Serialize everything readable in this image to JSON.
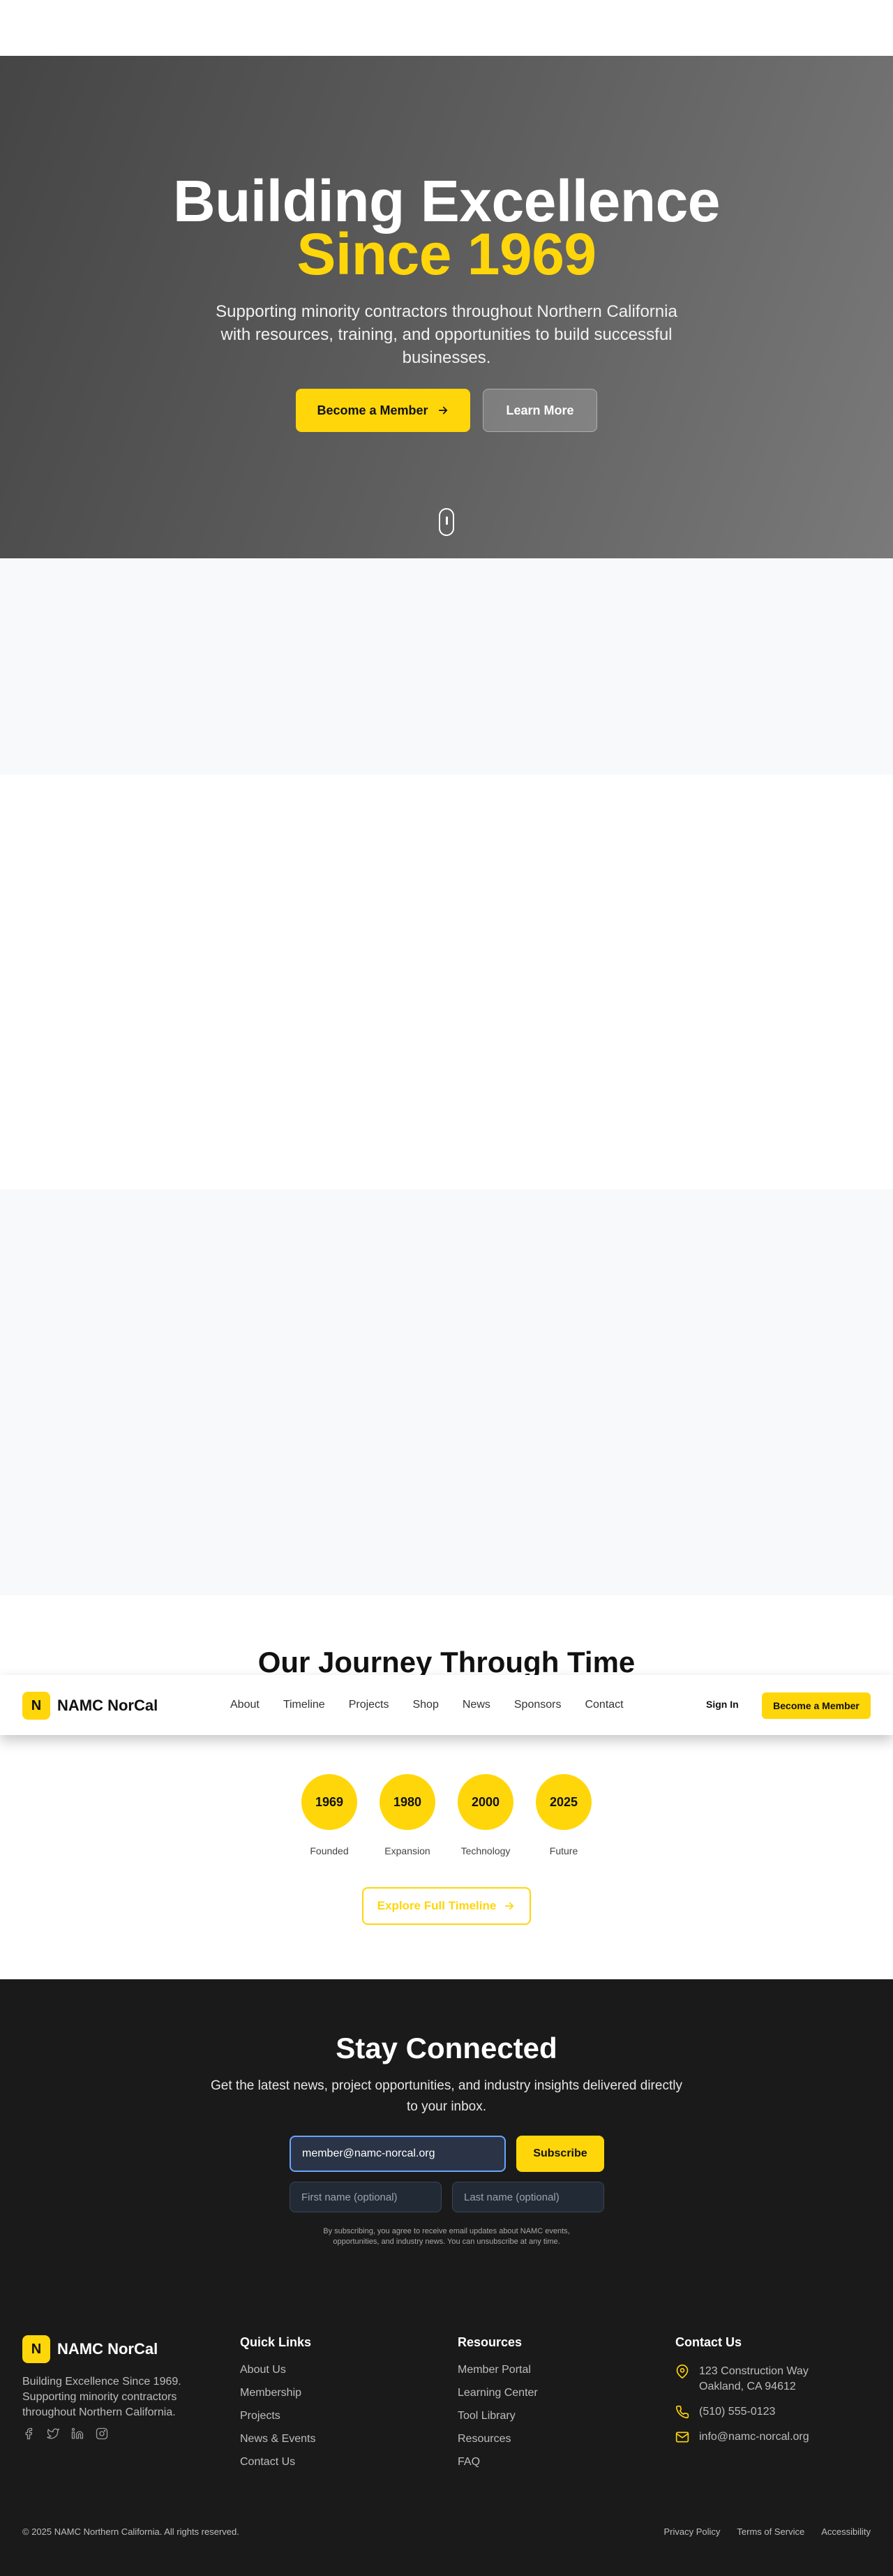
{
  "nav": {
    "logo_letter": "N",
    "brand": "NAMC NorCal",
    "links": [
      "About",
      "Timeline",
      "Projects",
      "Shop",
      "News",
      "Sponsors",
      "Contact"
    ],
    "sign_in": "Sign In",
    "cta": "Become a Member"
  },
  "hero": {
    "title_line1": "Building Excellence",
    "title_line2": "Since 1969",
    "subtitle": "Supporting minority contractors throughout Northern California with resources, training, and opportunities to build successful businesses.",
    "primary_button": "Become a Member",
    "secondary_button": "Learn More"
  },
  "timeline": {
    "title": "Our Journey Through Time",
    "items": [
      {
        "year": "1969",
        "label": "Founded"
      },
      {
        "year": "1980",
        "label": "Expansion"
      },
      {
        "year": "2000",
        "label": "Technology"
      },
      {
        "year": "2025",
        "label": "Future"
      }
    ],
    "button": "Explore Full Timeline"
  },
  "newsletter": {
    "title": "Stay Connected",
    "subtitle": "Get the latest news, project opportunities, and industry insights delivered directly to your inbox.",
    "email_value": "member@namc-norcal.org",
    "subscribe": "Subscribe",
    "first_name_placeholder": "First name (optional)",
    "last_name_placeholder": "Last name (optional)",
    "fine_print": "By subscribing, you agree to receive email updates about NAMC events, opportunities, and industry news. You can unsubscribe at any time."
  },
  "footer": {
    "logo_letter": "N",
    "brand": "NAMC NorCal",
    "description": "Building Excellence Since 1969. Supporting minority contractors throughout Northern California.",
    "quick_links": {
      "title": "Quick Links",
      "items": [
        "About Us",
        "Membership",
        "Projects",
        "News & Events",
        "Contact Us"
      ]
    },
    "resources": {
      "title": "Resources",
      "items": [
        "Member Portal",
        "Learning Center",
        "Tool Library",
        "Resources",
        "FAQ"
      ]
    },
    "contact": {
      "title": "Contact Us",
      "address_line1": "123 Construction Way",
      "address_line2": "Oakland, CA 94612",
      "phone": "(510) 555-0123",
      "email": "info@namc-norcal.org"
    },
    "copyright": "© 2025 NAMC Northern California. All rights reserved.",
    "legal": [
      "Privacy Policy",
      "Terms of Service",
      "Accessibility"
    ]
  },
  "colors": {
    "accent": "#FFD60A",
    "dark": "#1A1A1A",
    "hero_gray": "#5E5E5E"
  }
}
